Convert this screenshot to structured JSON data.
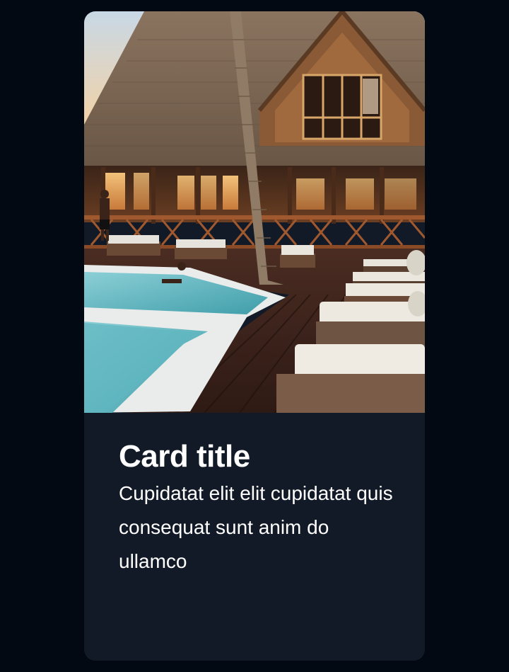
{
  "card": {
    "image_alt": "Resort with a pool, wooden deck, sun loungers and a palm tree in front of a lodge",
    "title": "Card title",
    "text": "Cupidatat elit elit cupidatat quis consequat sunt anim do ullamco"
  },
  "colors": {
    "page_background": "#020912",
    "card_background": "#131a27",
    "text": "#ffffff"
  }
}
